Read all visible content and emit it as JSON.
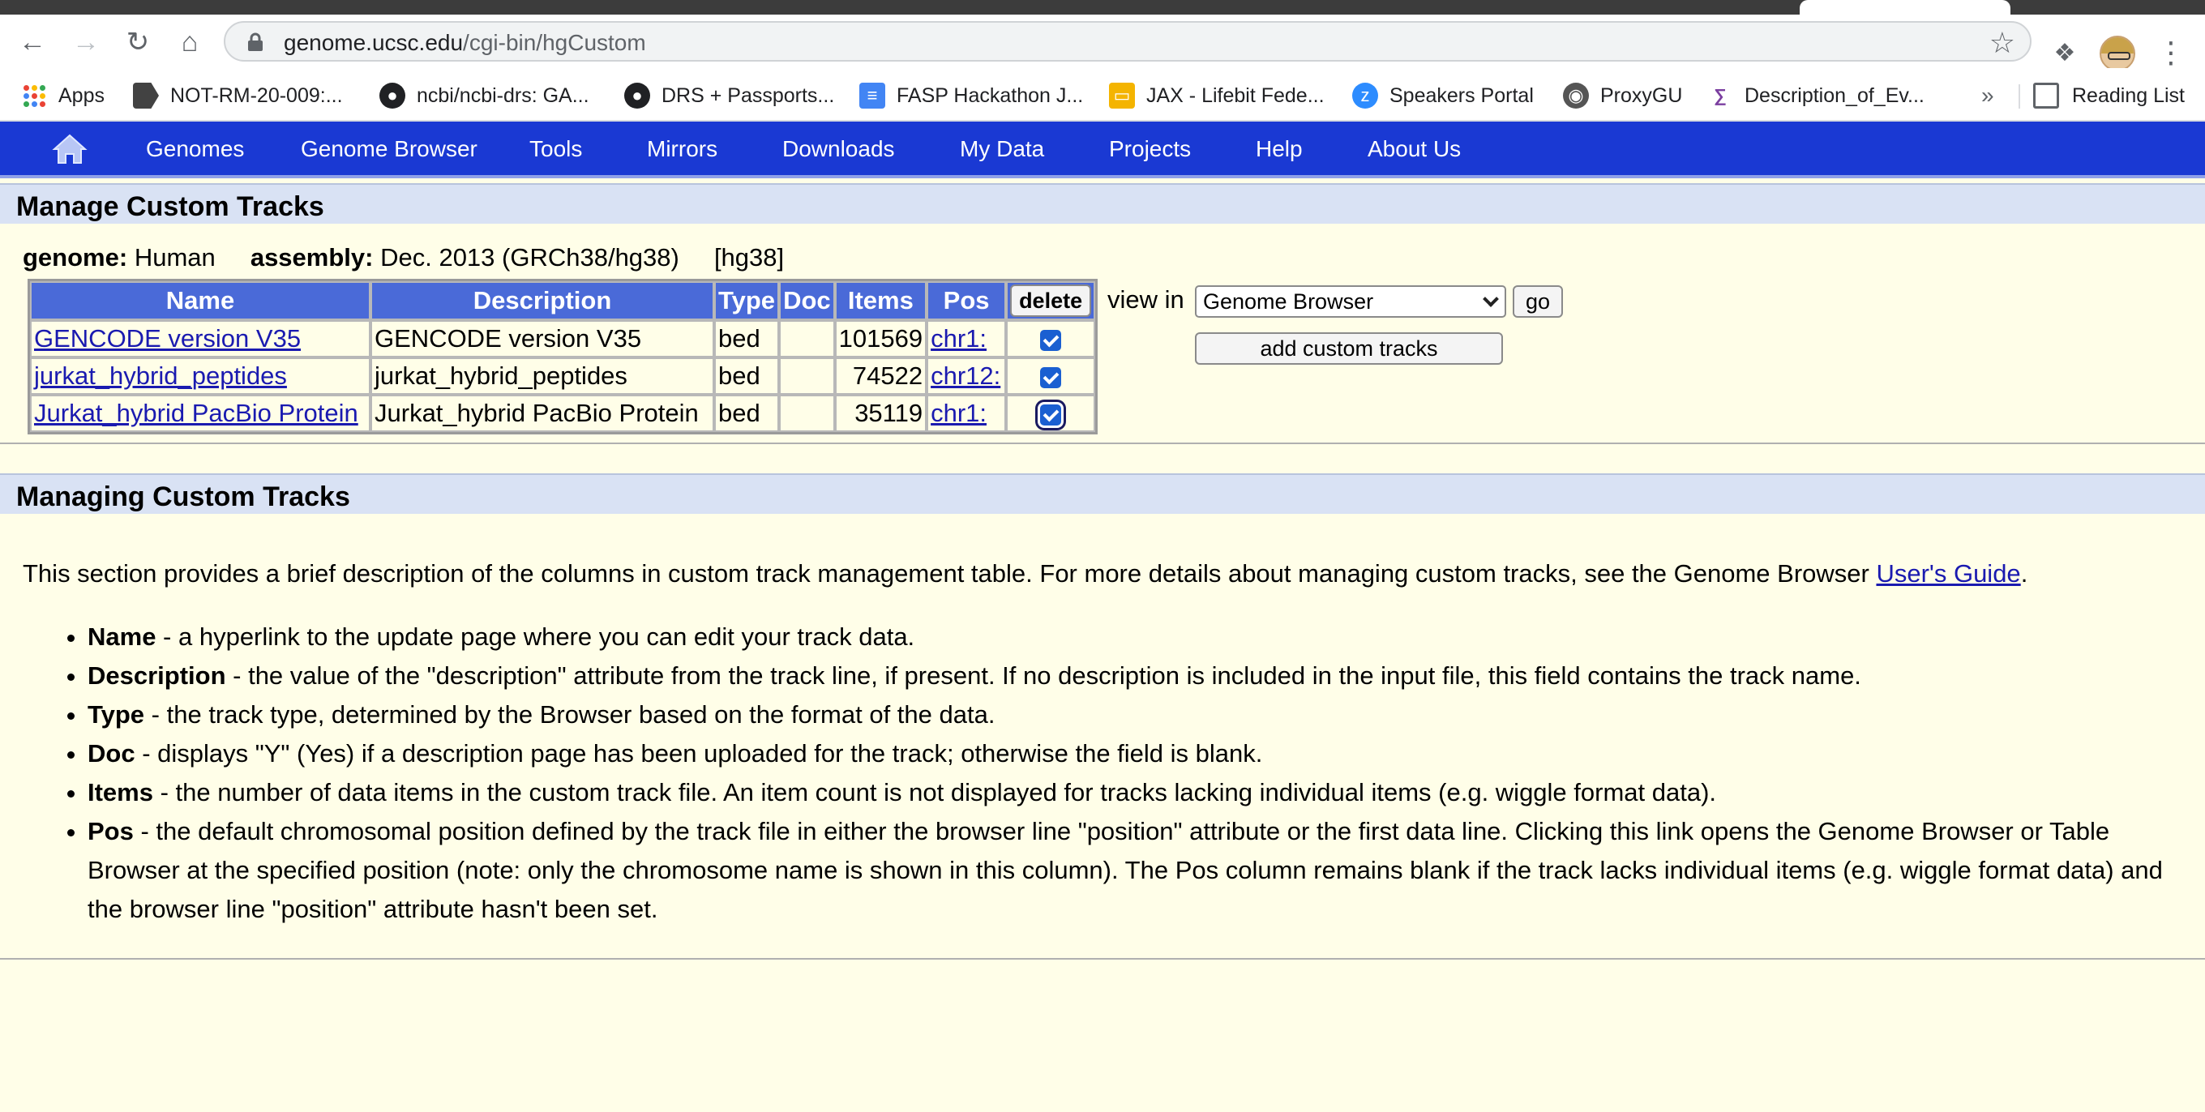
{
  "browser": {
    "url_host": "genome.ucsc.edu",
    "url_path": "/cgi-bin/hgCustom",
    "bookmarks": [
      {
        "label": "Apps",
        "icon": "apps-grid-icon"
      },
      {
        "label": "NOT-RM-20-009:...",
        "icon": "label-icon"
      },
      {
        "label": "ncbi/ncbi-drs: GA...",
        "icon": "github-icon"
      },
      {
        "label": "DRS + Passports...",
        "icon": "github-icon"
      },
      {
        "label": "FASP Hackathon J...",
        "icon": "google-docs-icon"
      },
      {
        "label": "JAX - Lifebit Fede...",
        "icon": "google-slides-icon"
      },
      {
        "label": "Speakers Portal",
        "icon": "zoom-icon"
      },
      {
        "label": "ProxyGU",
        "icon": "proxy-icon"
      },
      {
        "label": "Description_of_Ev...",
        "icon": "document-icon"
      }
    ],
    "more": "»",
    "reading_list": "Reading List"
  },
  "nav": {
    "items": [
      "Genomes",
      "Genome Browser",
      "Tools",
      "Mirrors",
      "Downloads",
      "My Data",
      "Projects",
      "Help",
      "About Us"
    ]
  },
  "manage": {
    "title": "Manage Custom Tracks",
    "genome_label": "genome:",
    "genome_value": "Human",
    "assembly_label": "assembly:",
    "assembly_value": "Dec. 2013 (GRCh38/hg38)",
    "db": "[hg38]",
    "table": {
      "headers": [
        "Name",
        "Description",
        "Type",
        "Doc",
        "Items",
        "Pos"
      ],
      "delete_label": "delete",
      "rows": [
        {
          "name": "GENCODE version V35",
          "description": "GENCODE version V35",
          "type": "bed",
          "doc": "",
          "items": "101569",
          "pos": "chr1:",
          "checked": true
        },
        {
          "name": "jurkat_hybrid_peptides",
          "description": "jurkat_hybrid_peptides",
          "type": "bed",
          "doc": "",
          "items": "74522",
          "pos": "chr12:",
          "checked": true
        },
        {
          "name": "Jurkat_hybrid PacBio Protein",
          "description": "Jurkat_hybrid PacBio Protein",
          "type": "bed",
          "doc": "",
          "items": "35119",
          "pos": "chr1:",
          "checked": true
        }
      ]
    },
    "view_in_label": "view in",
    "view_in_selected": "Genome Browser",
    "go_label": "go",
    "add_label": "add custom tracks"
  },
  "help": {
    "title": "Managing Custom Tracks",
    "intro": "This section provides a brief description of the columns in custom track management table. For more details about managing custom tracks, see the Genome Browser ",
    "intro_link": "User's Guide",
    "intro_end": ".",
    "items": [
      {
        "term": "Name",
        "text": " - a hyperlink to the update page where you can edit your track data."
      },
      {
        "term": "Description",
        "text": " - the value of the \"description\" attribute from the track line, if present. If no description is included in the input file, this field contains the track name."
      },
      {
        "term": "Type",
        "text": " - the track type, determined by the Browser based on the format of the data."
      },
      {
        "term": "Doc",
        "text": " - displays \"Y\" (Yes) if a description page has been uploaded for the track; otherwise the field is blank."
      },
      {
        "term": "Items",
        "text": " - the number of data items in the custom track file. An item count is not displayed for tracks lacking individual items (e.g. wiggle format data)."
      },
      {
        "term": "Pos",
        "text": " - the default chromosomal position defined by the track file in either the browser line \"position\" attribute or the first data line. Clicking this link opens the Genome Browser or Table Browser at the specified position (note: only the chromosome name is shown in this column). The Pos column remains blank if the track lacks individual items (e.g. wiggle format data) and the browser line \"position\" attribute hasn't been set."
      }
    ]
  },
  "colors": {
    "nav_bg": "#1a39d3",
    "header_bg": "#4a6ad8",
    "section_bg": "#d9e2f4",
    "page_bg": "#FFFEE8",
    "link": "#1a1ab0"
  }
}
